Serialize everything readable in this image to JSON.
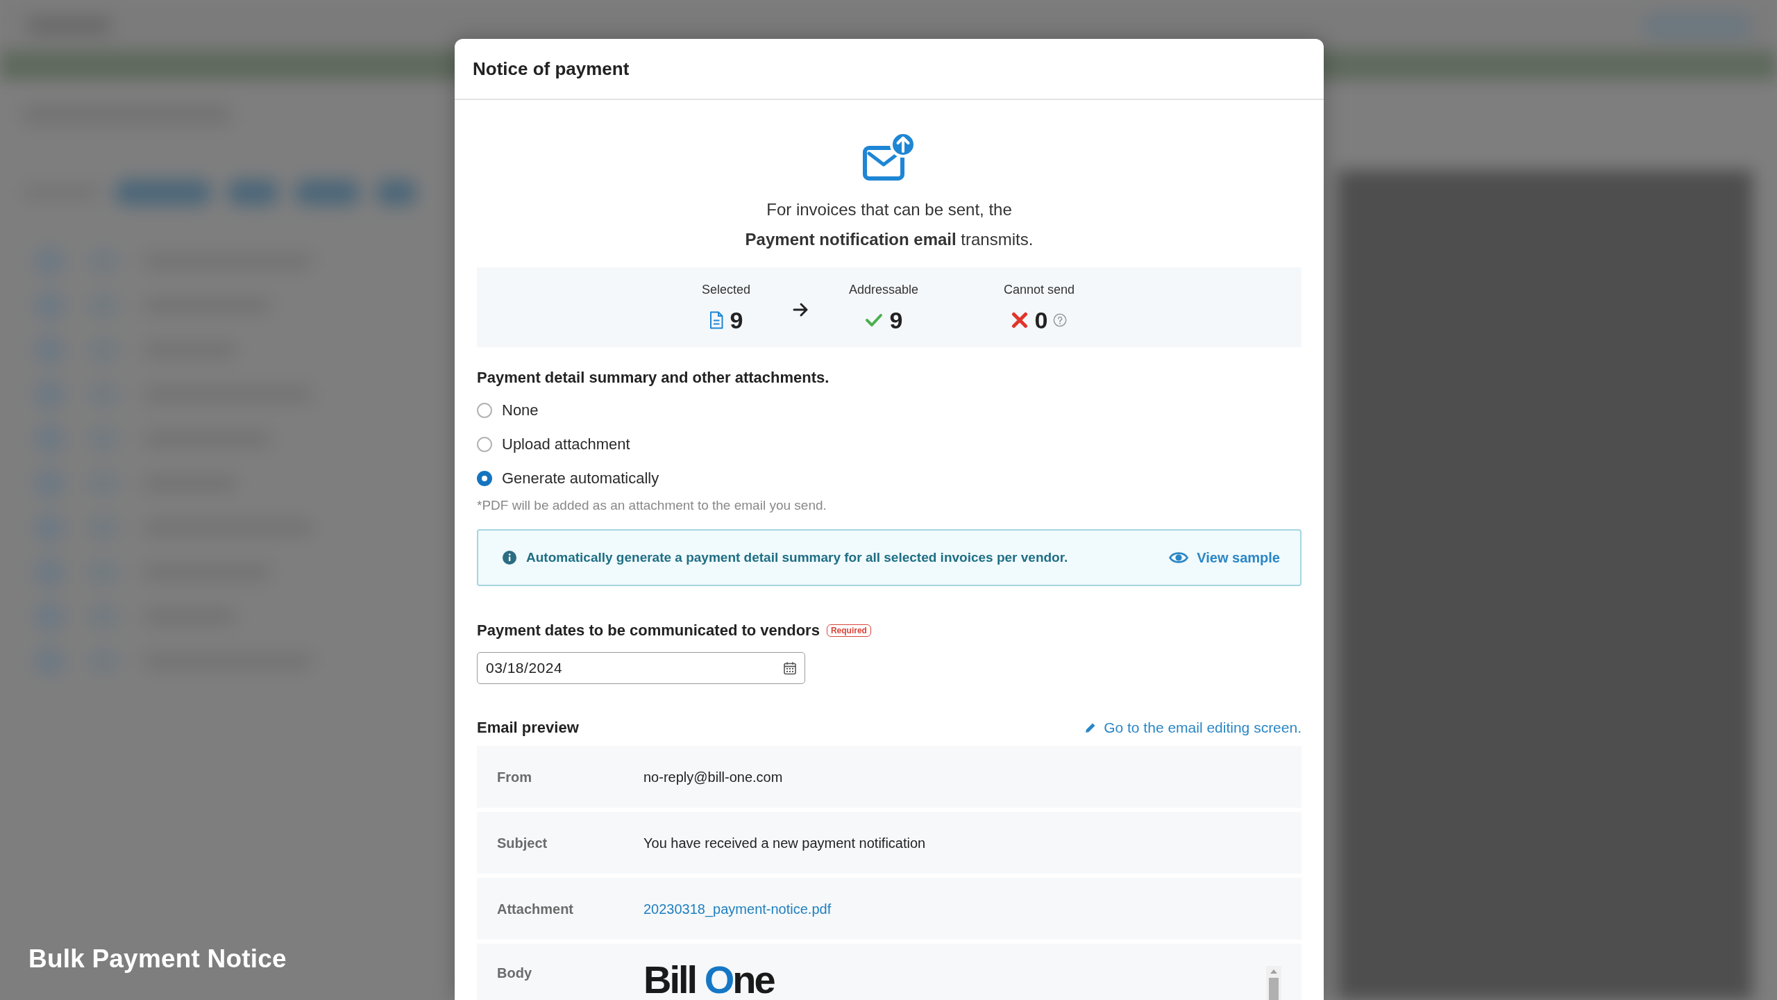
{
  "caption": "Bulk Payment Notice",
  "dialog": {
    "title": "Notice of payment"
  },
  "intro": "For invoices that can be sent, the\n**Payment notification email** transmits.",
  "counts": [
    {
      "label": "Selected",
      "value": "9",
      "kind": "document"
    },
    {
      "label": "Addressable",
      "value": "9",
      "kind": "ok"
    },
    {
      "label": "Cannot send",
      "value": "0",
      "kind": "error"
    }
  ],
  "attachments": {
    "heading": "Payment detail summary and other attachments.",
    "options": [
      {
        "label": "None",
        "selected": false
      },
      {
        "label": "Upload attachment",
        "selected": false
      },
      {
        "label": "Generate automatically",
        "selected": true
      }
    ],
    "note": "*PDF will be added as an attachment to the email you send."
  },
  "info_banner": {
    "message": "Automatically generate a payment detail summary for all selected invoices per vendor.",
    "link": "View sample"
  },
  "payment_date": {
    "label": "Payment dates to be communicated to vendors",
    "badge": "Required",
    "value": "03/18/2024"
  },
  "email_preview": {
    "heading": "Email preview",
    "edit_link": "Go to the email editing screen.",
    "rows": [
      {
        "label": "From",
        "kind": "text",
        "value": "no-reply@bill-one.com"
      },
      {
        "label": "Subject",
        "kind": "text",
        "value": "You have received a new payment notification"
      },
      {
        "label": "Attachment",
        "kind": "link",
        "value": "20230318_payment-notice.pdf"
      },
      {
        "label": "Body",
        "kind": "logo",
        "logo": [
          "Bill",
          "One"
        ]
      }
    ]
  }
}
